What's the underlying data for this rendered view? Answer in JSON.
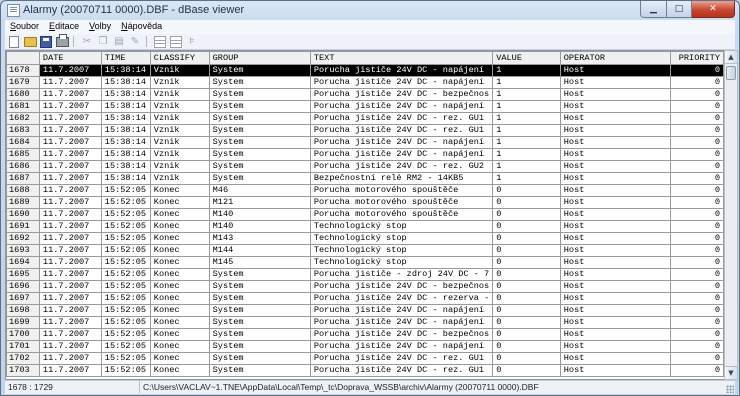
{
  "window": {
    "title": "Alarmy (20070711 0000).DBF - dBase viewer"
  },
  "menu": [
    {
      "underline": "S",
      "rest": "oubor"
    },
    {
      "underline": "E",
      "rest": "ditace"
    },
    {
      "underline": "V",
      "rest": "olby"
    },
    {
      "underline": "N",
      "rest": "ápověda"
    }
  ],
  "toolbar": {
    "icons": [
      "new-file-icon",
      "open-folder-icon",
      "save-icon",
      "print-icon",
      "cut-icon",
      "copy-icon",
      "paste-icon",
      "edit-icon",
      "column-icon",
      "table-icon",
      "filter-icon"
    ]
  },
  "columns": [
    "DATE",
    "TIME",
    "CLASSIFY",
    "GROUP",
    "TEXT",
    "VALUE",
    "OPERATOR",
    "PRIORITY"
  ],
  "selected_row": "1678",
  "rows": [
    [
      "1678",
      "11.7.2007",
      "15:38:14",
      "Vznik",
      "System",
      "Porucha jističe 24V DC - napájení",
      "1",
      "Host",
      "0"
    ],
    [
      "1679",
      "11.7.2007",
      "15:38:14",
      "Vznik",
      "System",
      "Porucha jističe 24V DC - napájení",
      "1",
      "Host",
      "0"
    ],
    [
      "1680",
      "11.7.2007",
      "15:38:14",
      "Vznik",
      "System",
      "Porucha jističe 24V DC - bezpečnos",
      "1",
      "Host",
      "0"
    ],
    [
      "1681",
      "11.7.2007",
      "15:38:14",
      "Vznik",
      "System",
      "Porucha jističe 24V DC - napájení",
      "1",
      "Host",
      "0"
    ],
    [
      "1682",
      "11.7.2007",
      "15:38:14",
      "Vznik",
      "System",
      "Porucha jističe 24V DC - rez. GU1",
      "1",
      "Host",
      "0"
    ],
    [
      "1683",
      "11.7.2007",
      "15:38:14",
      "Vznik",
      "System",
      "Porucha jističe 24V DC - rez. GU1",
      "1",
      "Host",
      "0"
    ],
    [
      "1684",
      "11.7.2007",
      "15:38:14",
      "Vznik",
      "System",
      "Porucha jističe 24V DC - napájení",
      "1",
      "Host",
      "0"
    ],
    [
      "1685",
      "11.7.2007",
      "15:38:14",
      "Vznik",
      "System",
      "Porucha jističe 24V DC - napájení",
      "1",
      "Host",
      "0"
    ],
    [
      "1686",
      "11.7.2007",
      "15:38:14",
      "Vznik",
      "System",
      "Porucha jističe 24V DC - rez. GU2",
      "1",
      "Host",
      "0"
    ],
    [
      "1687",
      "11.7.2007",
      "15:38:14",
      "Vznik",
      "System",
      "Bezpečnostní relé RM2 - 14KB5",
      "1",
      "Host",
      "0"
    ],
    [
      "1688",
      "11.7.2007",
      "15:52:05",
      "Konec",
      "M46",
      "Porucha motorového spouštěče",
      "0",
      "Host",
      "0"
    ],
    [
      "1689",
      "11.7.2007",
      "15:52:05",
      "Konec",
      "M121",
      "Porucha motorového spouštěče",
      "0",
      "Host",
      "0"
    ],
    [
      "1690",
      "11.7.2007",
      "15:52:05",
      "Konec",
      "M140",
      "Porucha motorového spouštěče",
      "0",
      "Host",
      "0"
    ],
    [
      "1691",
      "11.7.2007",
      "15:52:05",
      "Konec",
      "M140",
      "Technologický stop",
      "0",
      "Host",
      "0"
    ],
    [
      "1692",
      "11.7.2007",
      "15:52:05",
      "Konec",
      "M143",
      "Technologický stop",
      "0",
      "Host",
      "0"
    ],
    [
      "1693",
      "11.7.2007",
      "15:52:05",
      "Konec",
      "M144",
      "Technologický stop",
      "0",
      "Host",
      "0"
    ],
    [
      "1694",
      "11.7.2007",
      "15:52:05",
      "Konec",
      "M145",
      "Technologický stop",
      "0",
      "Host",
      "0"
    ],
    [
      "1695",
      "11.7.2007",
      "15:52:05",
      "Konec",
      "System",
      "Porucha jističe - zdroj 24V DC - 7",
      "0",
      "Host",
      "0"
    ],
    [
      "1696",
      "11.7.2007",
      "15:52:05",
      "Konec",
      "System",
      "Porucha jističe 24V DC - bezpečnos",
      "0",
      "Host",
      "0"
    ],
    [
      "1697",
      "11.7.2007",
      "15:52:05",
      "Konec",
      "System",
      "Porucha jističe 24V DC - rezerva -",
      "0",
      "Host",
      "0"
    ],
    [
      "1698",
      "11.7.2007",
      "15:52:05",
      "Konec",
      "System",
      "Porucha jističe 24V DC - napájení",
      "0",
      "Host",
      "0"
    ],
    [
      "1699",
      "11.7.2007",
      "15:52:05",
      "Konec",
      "System",
      "Porucha jističe 24V DC - napájení",
      "0",
      "Host",
      "0"
    ],
    [
      "1700",
      "11.7.2007",
      "15:52:05",
      "Konec",
      "System",
      "Porucha jističe 24V DC - bezpečnos",
      "0",
      "Host",
      "0"
    ],
    [
      "1701",
      "11.7.2007",
      "15:52:05",
      "Konec",
      "System",
      "Porucha jističe 24V DC - napájení",
      "0",
      "Host",
      "0"
    ],
    [
      "1702",
      "11.7.2007",
      "15:52:05",
      "Konec",
      "System",
      "Porucha jističe 24V DC - rez. GU1",
      "0",
      "Host",
      "0"
    ],
    [
      "1703",
      "11.7.2007",
      "15:52:05",
      "Konec",
      "System",
      "Porucha jističe 24V DC - rez. GU1",
      "0",
      "Host",
      "0"
    ]
  ],
  "status": {
    "position": "1678 : 1729",
    "path": "C:\\Users\\VACLAV~1.TNE\\AppData\\Local\\Temp\\_tc\\Doprava_WSSB\\archiv\\Alarmy (20070711 0000).DBF"
  }
}
